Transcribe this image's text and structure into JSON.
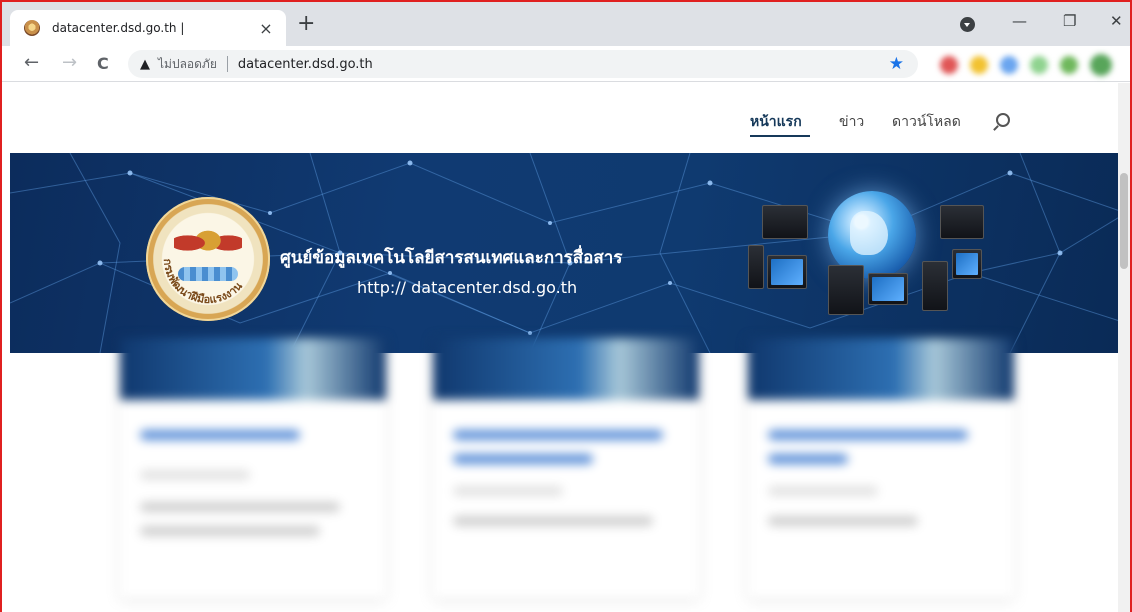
{
  "browser": {
    "tab": {
      "title": "datacenter.dsd.go.th |",
      "close_glyph": "×"
    },
    "new_tab_glyph": "+",
    "window_controls": {
      "minimize": "—",
      "restore": "❐",
      "close": "✕"
    },
    "nav": {
      "back": "←",
      "forward": "→",
      "reload": "C"
    },
    "address": {
      "warning_glyph": "▲",
      "security_label": "ไม่ปลอดภัย",
      "url": "datacenter.dsd.go.th"
    },
    "bookmark_star": "★"
  },
  "site": {
    "nav": {
      "items": [
        {
          "label": "หน้าแรก",
          "active": true
        },
        {
          "label": "ข่าว",
          "active": false
        },
        {
          "label": "ดาวน์โหลด",
          "active": false
        }
      ]
    },
    "banner": {
      "title": "ศูนย์ข้อมูลเทคโนโลยีสารสนเทศและการสื่อสาร",
      "url": "http:// datacenter.dsd.go.th",
      "seal_ring_text": "กรมพัฒนาฝีมือแรงงาน"
    }
  },
  "colors": {
    "accent": "#16395a",
    "frame_border": "#e02020",
    "star": "#1a73e8",
    "banner_dark": "#0c2c5c"
  },
  "icons": {
    "search": "search-icon",
    "favicon": "seal-favicon-icon",
    "warning": "warning-icon"
  }
}
